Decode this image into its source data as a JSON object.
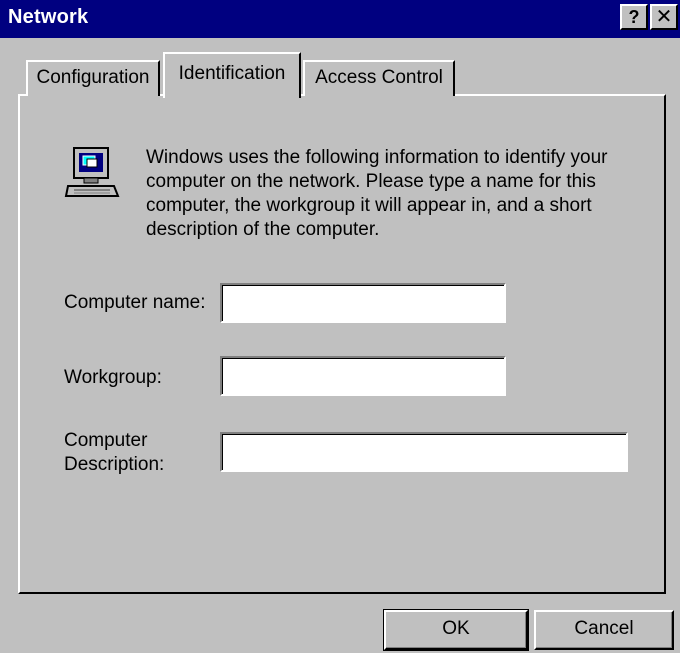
{
  "window": {
    "title": "Network",
    "help_glyph": "?",
    "close_glyph": "✕"
  },
  "tabs": [
    {
      "label": "Configuration",
      "active": false
    },
    {
      "label": "Identification",
      "active": true
    },
    {
      "label": "Access Control",
      "active": false
    }
  ],
  "intro": {
    "icon": "computer-icon",
    "text": "Windows uses the following information to identify your computer on the network.  Please type a name for this computer, the workgroup it will appear in, and a short description of the computer."
  },
  "form": {
    "computer_name": {
      "label": "Computer name:",
      "value": ""
    },
    "workgroup": {
      "label": "Workgroup:",
      "value": ""
    },
    "description": {
      "label_line1": "Computer",
      "label_line2": "Description:",
      "value": ""
    }
  },
  "buttons": {
    "ok": "OK",
    "cancel": "Cancel"
  },
  "colors": {
    "titlebar": "#000080",
    "face": "#c0c0c0"
  }
}
